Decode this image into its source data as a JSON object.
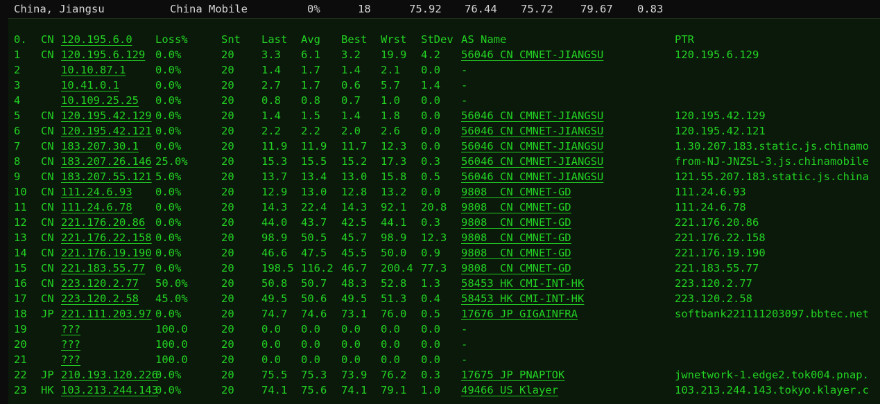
{
  "summary": {
    "location": "China, Jiangsu",
    "isp": "China Mobile",
    "loss": "0%",
    "sent": "18",
    "last": "75.92",
    "avg": "76.44",
    "best": "75.72",
    "worst": "79.67",
    "stdev": "0.83"
  },
  "header": {
    "hop": "0.",
    "cc": "CN",
    "host": "120.195.6.0",
    "loss": "Loss%",
    "snt": "Snt",
    "last": "Last",
    "avg": "Avg",
    "best": "Best",
    "wrst": "Wrst",
    "stdev": "StDev",
    "as_name": "AS Name",
    "ptr": "PTR"
  },
  "hops": [
    {
      "hop": "1",
      "cc": "CN",
      "host": "120.195.6.129",
      "loss": "0.0%",
      "snt": "20",
      "last": "3.3",
      "avg": "6.1",
      "best": "3.2",
      "wrst": "19.9",
      "stdev": "4.2",
      "as": "56046 CN CMNET-JIANGSU",
      "ptr": "120.195.6.129"
    },
    {
      "hop": "2",
      "cc": "",
      "host": "10.10.87.1",
      "loss": "0.0%",
      "snt": "20",
      "last": "1.4",
      "avg": "1.7",
      "best": "1.4",
      "wrst": "2.1",
      "stdev": "0.0",
      "as": "-",
      "ptr": ""
    },
    {
      "hop": "3",
      "cc": "",
      "host": "10.41.0.1",
      "loss": "0.0%",
      "snt": "20",
      "last": "2.7",
      "avg": "1.7",
      "best": "0.6",
      "wrst": "5.7",
      "stdev": "1.4",
      "as": "-",
      "ptr": ""
    },
    {
      "hop": "4",
      "cc": "",
      "host": "10.109.25.25",
      "loss": "0.0%",
      "snt": "20",
      "last": "0.8",
      "avg": "0.8",
      "best": "0.7",
      "wrst": "1.0",
      "stdev": "0.0",
      "as": "-",
      "ptr": ""
    },
    {
      "hop": "5",
      "cc": "CN",
      "host": "120.195.42.129",
      "loss": "0.0%",
      "snt": "20",
      "last": "1.4",
      "avg": "1.5",
      "best": "1.4",
      "wrst": "1.8",
      "stdev": "0.0",
      "as": "56046 CN CMNET-JIANGSU",
      "ptr": "120.195.42.129"
    },
    {
      "hop": "6",
      "cc": "CN",
      "host": "120.195.42.121",
      "loss": "0.0%",
      "snt": "20",
      "last": "2.2",
      "avg": "2.2",
      "best": "2.0",
      "wrst": "2.6",
      "stdev": "0.0",
      "as": "56046 CN CMNET-JIANGSU",
      "ptr": "120.195.42.121"
    },
    {
      "hop": "7",
      "cc": "CN",
      "host": "183.207.30.1",
      "loss": "0.0%",
      "snt": "20",
      "last": "11.9",
      "avg": "11.9",
      "best": "11.7",
      "wrst": "12.3",
      "stdev": "0.0",
      "as": "56046 CN CMNET-JIANGSU",
      "ptr": "1.30.207.183.static.js.chinamo"
    },
    {
      "hop": "8",
      "cc": "CN",
      "host": "183.207.26.146",
      "loss": "25.0%",
      "snt": "20",
      "last": "15.3",
      "avg": "15.5",
      "best": "15.2",
      "wrst": "17.3",
      "stdev": "0.3",
      "as": "56046 CN CMNET-JIANGSU",
      "ptr": "from-NJ-JNZSL-3.js.chinamobile"
    },
    {
      "hop": "9",
      "cc": "CN",
      "host": "183.207.55.121",
      "loss": "5.0%",
      "snt": "20",
      "last": "13.7",
      "avg": "13.4",
      "best": "13.0",
      "wrst": "15.8",
      "stdev": "0.5",
      "as": "56046 CN CMNET-JIANGSU",
      "ptr": "121.55.207.183.static.js.china"
    },
    {
      "hop": "10",
      "cc": "CN",
      "host": "111.24.6.93",
      "loss": "0.0%",
      "snt": "20",
      "last": "12.9",
      "avg": "13.0",
      "best": "12.8",
      "wrst": "13.2",
      "stdev": "0.0",
      "as": "9808  CN CMNET-GD",
      "ptr": "111.24.6.93"
    },
    {
      "hop": "11",
      "cc": "CN",
      "host": "111.24.6.78",
      "loss": "0.0%",
      "snt": "20",
      "last": "14.3",
      "avg": "22.4",
      "best": "14.3",
      "wrst": "92.1",
      "stdev": "20.8",
      "as": "9808  CN CMNET-GD",
      "ptr": "111.24.6.78"
    },
    {
      "hop": "12",
      "cc": "CN",
      "host": "221.176.20.86",
      "loss": "0.0%",
      "snt": "20",
      "last": "44.0",
      "avg": "43.7",
      "best": "42.5",
      "wrst": "44.1",
      "stdev": "0.3",
      "as": "9808  CN CMNET-GD",
      "ptr": "221.176.20.86"
    },
    {
      "hop": "13",
      "cc": "CN",
      "host": "221.176.22.158",
      "loss": "0.0%",
      "snt": "20",
      "last": "98.9",
      "avg": "50.5",
      "best": "45.7",
      "wrst": "98.9",
      "stdev": "12.3",
      "as": "9808  CN CMNET-GD",
      "ptr": "221.176.22.158"
    },
    {
      "hop": "14",
      "cc": "CN",
      "host": "221.176.19.190",
      "loss": "0.0%",
      "snt": "20",
      "last": "46.6",
      "avg": "47.5",
      "best": "45.5",
      "wrst": "50.0",
      "stdev": "0.9",
      "as": "9808  CN CMNET-GD",
      "ptr": "221.176.19.190"
    },
    {
      "hop": "15",
      "cc": "CN",
      "host": "221.183.55.77",
      "loss": "0.0%",
      "snt": "20",
      "last": "198.5",
      "avg": "116.2",
      "best": "46.7",
      "wrst": "200.4",
      "stdev": "77.3",
      "as": "9808  CN CMNET-GD",
      "ptr": "221.183.55.77"
    },
    {
      "hop": "16",
      "cc": "CN",
      "host": "223.120.2.77",
      "loss": "50.0%",
      "snt": "20",
      "last": "50.8",
      "avg": "50.7",
      "best": "48.3",
      "wrst": "52.8",
      "stdev": "1.3",
      "as": "58453 HK CMI-INT-HK",
      "ptr": "223.120.2.77"
    },
    {
      "hop": "17",
      "cc": "CN",
      "host": "223.120.2.58",
      "loss": "45.0%",
      "snt": "20",
      "last": "49.5",
      "avg": "50.6",
      "best": "49.5",
      "wrst": "51.3",
      "stdev": "0.4",
      "as": "58453 HK CMI-INT-HK",
      "ptr": "223.120.2.58"
    },
    {
      "hop": "18",
      "cc": "JP",
      "host": "221.111.203.97",
      "loss": "0.0%",
      "snt": "20",
      "last": "74.7",
      "avg": "74.6",
      "best": "73.1",
      "wrst": "76.0",
      "stdev": "0.5",
      "as": "17676 JP GIGAINFRA",
      "ptr": "softbank221111203097.bbtec.net"
    },
    {
      "hop": "19",
      "cc": "",
      "host": "???",
      "loss": "100.0",
      "snt": "20",
      "last": "0.0",
      "avg": "0.0",
      "best": "0.0",
      "wrst": "0.0",
      "stdev": "0.0",
      "as": "-",
      "ptr": ""
    },
    {
      "hop": "20",
      "cc": "",
      "host": "???",
      "loss": "100.0",
      "snt": "20",
      "last": "0.0",
      "avg": "0.0",
      "best": "0.0",
      "wrst": "0.0",
      "stdev": "0.0",
      "as": "-",
      "ptr": ""
    },
    {
      "hop": "21",
      "cc": "",
      "host": "???",
      "loss": "100.0",
      "snt": "20",
      "last": "0.0",
      "avg": "0.0",
      "best": "0.0",
      "wrst": "0.0",
      "stdev": "0.0",
      "as": "-",
      "ptr": ""
    },
    {
      "hop": "22",
      "cc": "JP",
      "host": "210.193.120.226",
      "loss": "0.0%",
      "snt": "20",
      "last": "75.5",
      "avg": "75.3",
      "best": "73.9",
      "wrst": "76.2",
      "stdev": "0.3",
      "as": "17675 JP PNAPTOK",
      "ptr": "jwnetwork-1.edge2.tok004.pnap."
    },
    {
      "hop": "23",
      "cc": "HK",
      "host": "103.213.244.143",
      "loss": "0.0%",
      "snt": "20",
      "last": "74.1",
      "avg": "75.6",
      "best": "74.1",
      "wrst": "79.1",
      "stdev": "1.0",
      "as": "49466 US Klayer",
      "ptr": "103.213.244.143.tokyo.klayer.c"
    }
  ]
}
